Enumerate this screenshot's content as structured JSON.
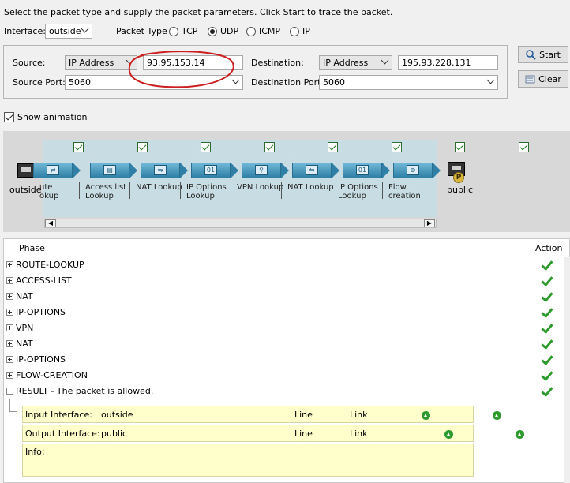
{
  "instruction": "Select the packet type and supply the packet parameters. Click Start to trace the packet.",
  "interface": {
    "label": "Interface:",
    "value": "outside"
  },
  "packet_type": {
    "label": "Packet Type",
    "options": [
      "TCP",
      "UDP",
      "ICMP",
      "IP"
    ],
    "selected": "UDP"
  },
  "source": {
    "label": "Source:",
    "type": "IP Address",
    "ip": "93.95.153.14",
    "port_label": "Source Port:",
    "port": "5060"
  },
  "destination": {
    "label": "Destination:",
    "type": "IP Address",
    "ip": "195.93.228.131",
    "port_label": "Destination Port:",
    "port": "5060"
  },
  "buttons": {
    "start": "Start",
    "clear": "Clear"
  },
  "show_animation": "Show animation",
  "flow": {
    "left_endpoint": "outside",
    "right_endpoint": "public",
    "right_badge": "P",
    "stages": [
      {
        "line1": "ute",
        "line2": "okup",
        "icon": "route-lookup-icon"
      },
      {
        "line1": "Access list",
        "line2": "Lookup",
        "icon": "access-list-icon"
      },
      {
        "line1": "NAT Lookup",
        "line2": "",
        "icon": "nat-icon"
      },
      {
        "line1": "IP Options",
        "line2": "Lookup",
        "icon": "ip-options-icon"
      },
      {
        "line1": "VPN Lookup",
        "line2": "",
        "icon": "vpn-icon"
      },
      {
        "line1": "NAT Lookup",
        "line2": "",
        "icon": "nat-icon"
      },
      {
        "line1": "IP Options",
        "line2": "Lookup",
        "icon": "ip-options-icon"
      },
      {
        "line1": "Flow",
        "line2": "creation",
        "icon": "flow-creation-icon"
      }
    ]
  },
  "table": {
    "col_phase": "Phase",
    "col_action": "Action",
    "rows": [
      "ROUTE-LOOKUP",
      "ACCESS-LIST",
      "NAT",
      "IP-OPTIONS",
      "VPN",
      "NAT",
      "IP-OPTIONS",
      "FLOW-CREATION"
    ],
    "result": "RESULT - The packet is allowed."
  },
  "result_detail": {
    "input_label": "Input Interface:",
    "input_value": "outside",
    "output_label": "Output Interface:",
    "output_value": "public",
    "line_label": "Line",
    "link_label": "Link",
    "info_label": "Info:"
  },
  "colors": {
    "annotation": "#cc1f1f",
    "accent": "#2e9a2e",
    "flow_bg": "#c8dde3"
  }
}
